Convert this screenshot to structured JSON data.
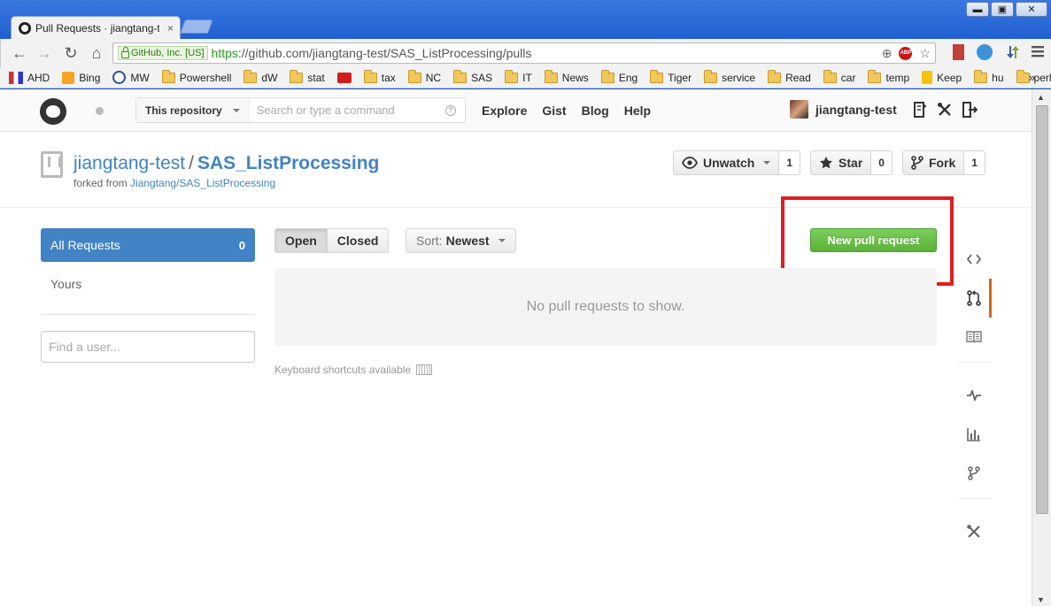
{
  "browser": {
    "tab_title": "Pull Requests · jiangtang-test",
    "tab_close": "×",
    "window_buttons": [
      "▬",
      "▣",
      "✕"
    ],
    "nav": {
      "back": "←",
      "forward": "→",
      "reload": "↻",
      "home": "⌂"
    },
    "security_label": "GitHub, Inc. [US]",
    "url_scheme": "https",
    "url_rest": "://github.com/jiangtang-test/SAS_ListProcessing/pulls",
    "omnibox_icons": {
      "zoom": "⊕",
      "abp": "ABP",
      "star": "☆"
    },
    "bookmarks": [
      "AHD",
      "Bing",
      "MW",
      "Powershell",
      "dW",
      "stat",
      "",
      "tax",
      "NC",
      "SAS",
      "IT",
      "News",
      "Eng",
      "Tiger",
      "service",
      "Read",
      "car",
      "temp",
      "Keep",
      "hu",
      "perl"
    ],
    "bookmarks_more": "»"
  },
  "header": {
    "scope_label": "This repository",
    "search_placeholder": "Search or type a command",
    "help_glyph": "?",
    "nav": [
      "Explore",
      "Gist",
      "Blog",
      "Help"
    ],
    "username": "jiangtang-test"
  },
  "repo": {
    "owner": "jiangtang-test",
    "separator": "/",
    "name": "SAS_ListProcessing",
    "forked_prefix": "forked from ",
    "forked_source": "Jiangtang/SAS_ListProcessing",
    "actions": {
      "unwatch": {
        "label": "Unwatch",
        "count": "1"
      },
      "star": {
        "label": "Star",
        "count": "0"
      },
      "fork": {
        "label": "Fork",
        "count": "1"
      }
    }
  },
  "sidebar": {
    "items": [
      {
        "label": "All Requests",
        "count": "0"
      },
      {
        "label": "Yours"
      }
    ],
    "find_user_placeholder": "Find a user..."
  },
  "main": {
    "state_tabs": [
      "Open",
      "Closed"
    ],
    "sort_label": "Sort:",
    "sort_value": "Newest",
    "new_pr_label": "New pull request",
    "empty_message": "No pull requests to show.",
    "shortcuts_label": "Keyboard shortcuts available"
  },
  "colors": {
    "accent_link": "#4183c4",
    "new_pr_green": "#5bb13a",
    "highlight_red": "#e01e24",
    "active_nav_orange": "#d26911"
  }
}
